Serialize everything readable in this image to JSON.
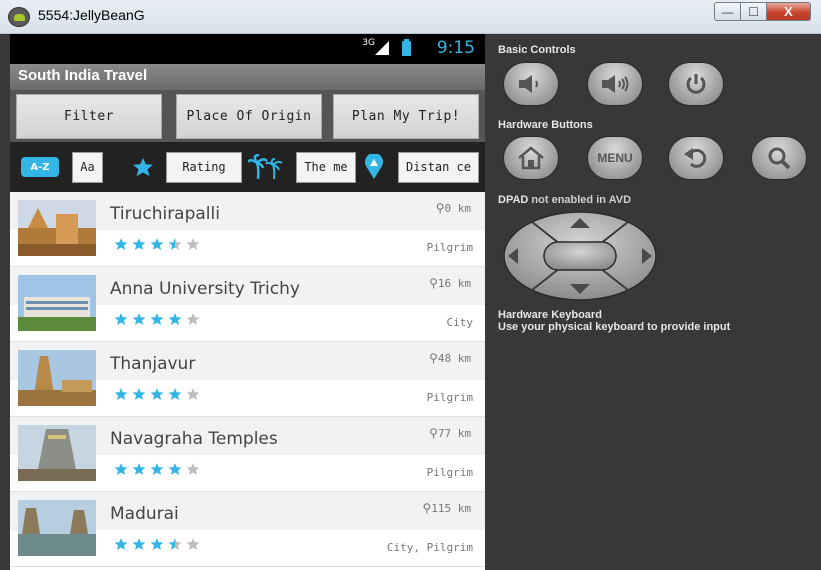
{
  "window": {
    "title": "5554:JellyBeanG",
    "minimize_glyph": "—",
    "maximize_glyph": "☐",
    "close_glyph": "X"
  },
  "statusbar": {
    "network": "3G",
    "time": "9:15"
  },
  "app": {
    "title": "South India Travel"
  },
  "buttons": {
    "filter": "Filter",
    "place_of_origin": "Place Of Origin",
    "plan_trip": "Plan My Trip!"
  },
  "sort_bar": {
    "az_icon": "A-Z",
    "alpha_label": "Aa",
    "rating_label": "Rating",
    "theme_label": "The me",
    "distance_label": "Distan ce",
    "icons": [
      "az-sort-icon",
      "star-icon",
      "palm-tree-icon",
      "location-pin-icon"
    ]
  },
  "places": [
    {
      "name": "Tiruchirapalli",
      "distance": "0 km",
      "rating": 3.5,
      "category": "Pilgrim"
    },
    {
      "name": "Anna University Trichy",
      "distance": "16 km",
      "rating": 4,
      "category": "City"
    },
    {
      "name": "Thanjavur",
      "distance": "48 km",
      "rating": 4,
      "category": "Pilgrim"
    },
    {
      "name": "Navagraha Temples",
      "distance": "77 km",
      "rating": 4,
      "category": "Pilgrim"
    },
    {
      "name": "Madurai",
      "distance": "115 km",
      "rating": 3.5,
      "category": "City, Pilgrim"
    }
  ],
  "controls": {
    "basic_controls_label": "Basic Controls",
    "hardware_buttons_label": "Hardware Buttons",
    "menu_label": "MENU",
    "dpad_label_bold": "DPAD",
    "dpad_label_rest": "not enabled in AVD",
    "keyboard_title": "Hardware Keyboard",
    "keyboard_hint": "Use your physical keyboard to provide input"
  },
  "colors": {
    "accent": "#33b5e5",
    "star_empty": "#bdbdbd",
    "emulator_bg": "#383838"
  }
}
